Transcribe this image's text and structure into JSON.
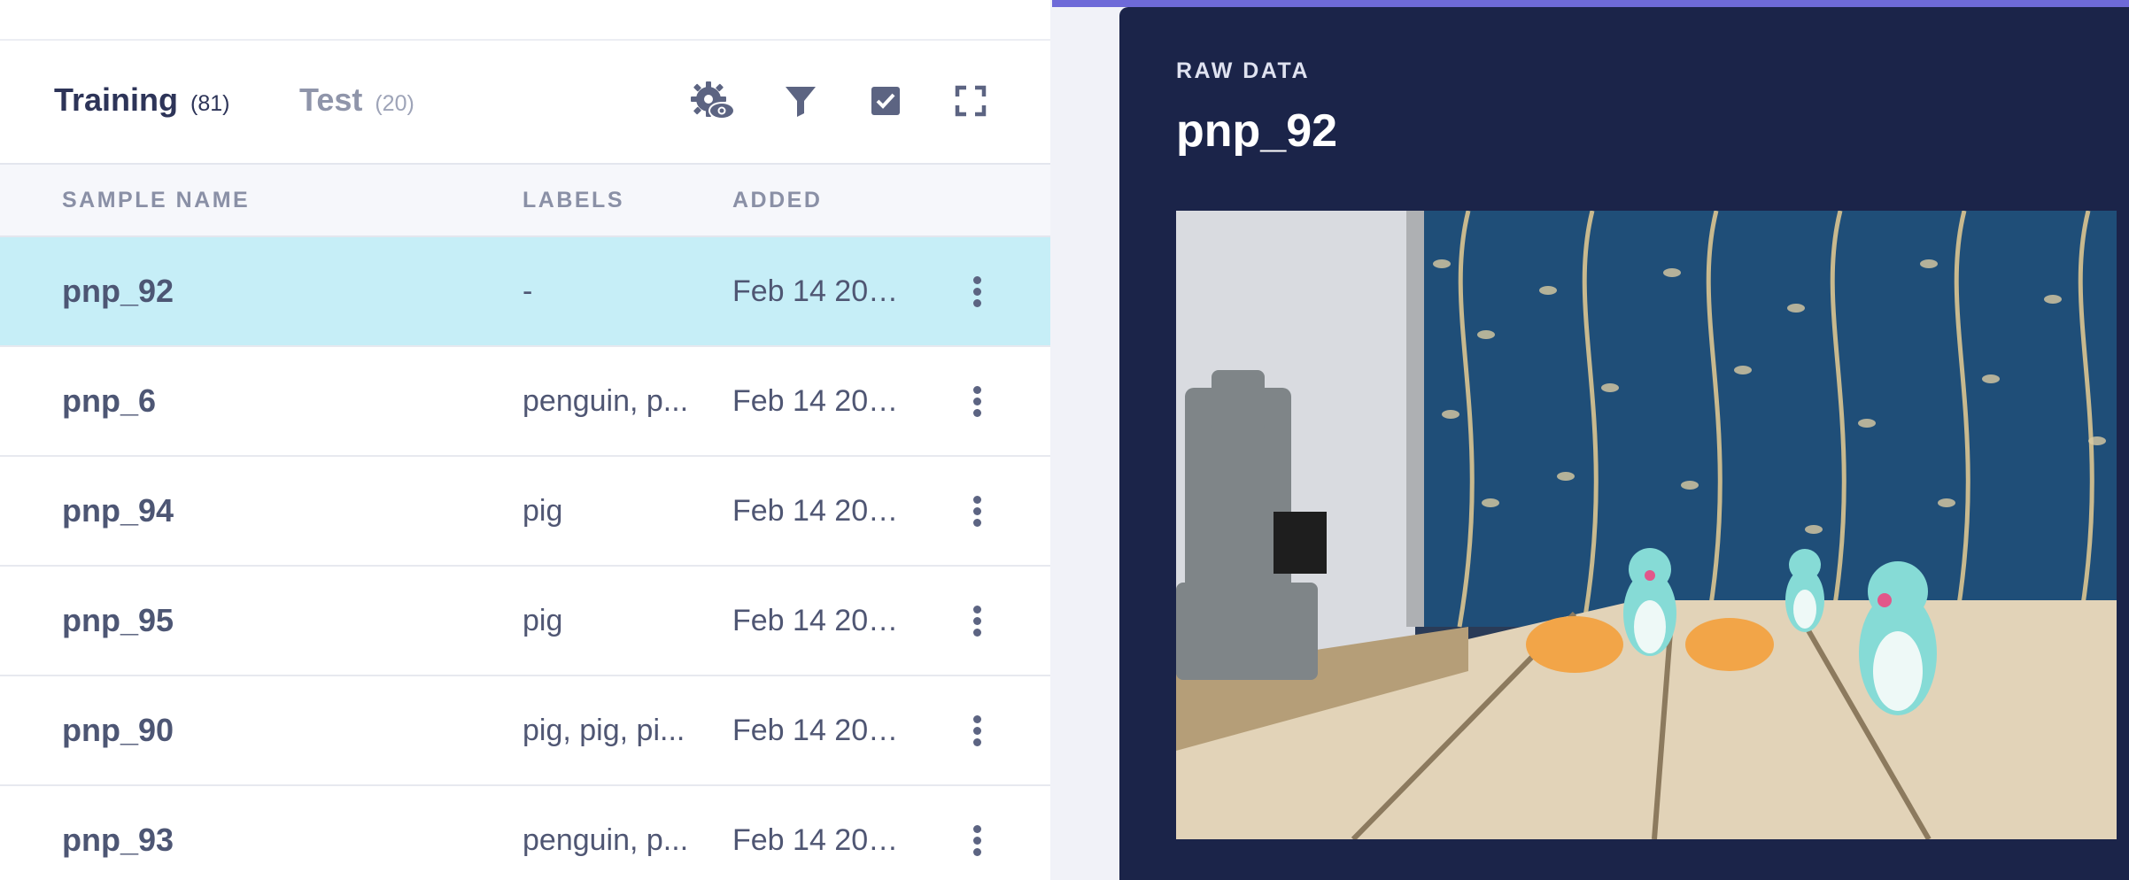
{
  "tabs": [
    {
      "label": "Training",
      "count": "(81)"
    },
    {
      "label": "Test",
      "count": "(20)"
    }
  ],
  "toolbar": [
    {
      "icon": "gear-eye-icon"
    },
    {
      "icon": "filter-icon"
    },
    {
      "icon": "checkbox-icon"
    },
    {
      "icon": "fullscreen-icon"
    }
  ],
  "table": {
    "columns": [
      "SAMPLE NAME",
      "LABELS",
      "ADDED"
    ],
    "rows": [
      {
        "name": "pnp_92",
        "labels": "-",
        "added": "Feb 14 202...",
        "selected": true
      },
      {
        "name": "pnp_6",
        "labels": "penguin, p...",
        "added": "Feb 14 202..."
      },
      {
        "name": "pnp_94",
        "labels": "pig",
        "added": "Feb 14 202..."
      },
      {
        "name": "pnp_95",
        "labels": "pig",
        "added": "Feb 14 202..."
      },
      {
        "name": "pnp_90",
        "labels": "pig, pig, pi...",
        "added": "Feb 14 202..."
      },
      {
        "name": "pnp_93",
        "labels": "penguin, p...",
        "added": "Feb 14 202..."
      }
    ]
  },
  "raw_data": {
    "section_label": "RAW DATA",
    "title": "pnp_92"
  },
  "colors": {
    "accent": "#6e6ad8",
    "panel_dark": "#1b2449",
    "selected_row": "#c6eef7",
    "text_primary": "#2d3458"
  }
}
